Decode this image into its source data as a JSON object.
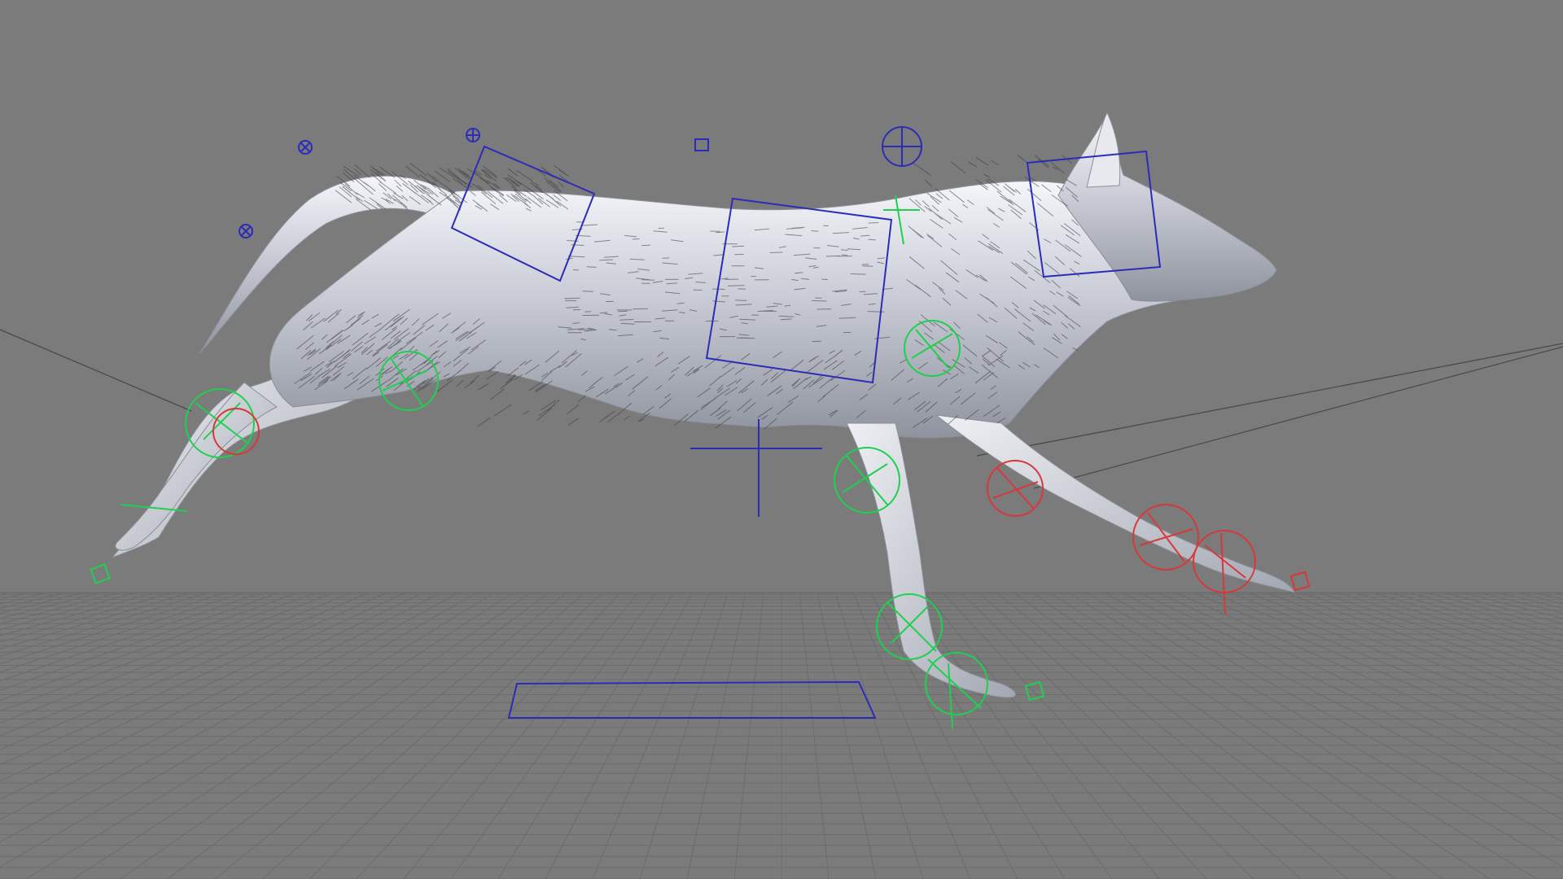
{
  "viewport": {
    "subject": "wolf-rig",
    "background": "#7b7b7b",
    "grid_color": "#6c6c6c",
    "mesh_color": "#dde0e8",
    "fur_color": "#3a3a3e",
    "ik_color": "#1fd04f",
    "fk_color": "#d6393a",
    "ctrl_color": "#2c2cb8"
  },
  "icons": {
    "move": "crosshair-icon",
    "pivot": "locator-icon"
  }
}
